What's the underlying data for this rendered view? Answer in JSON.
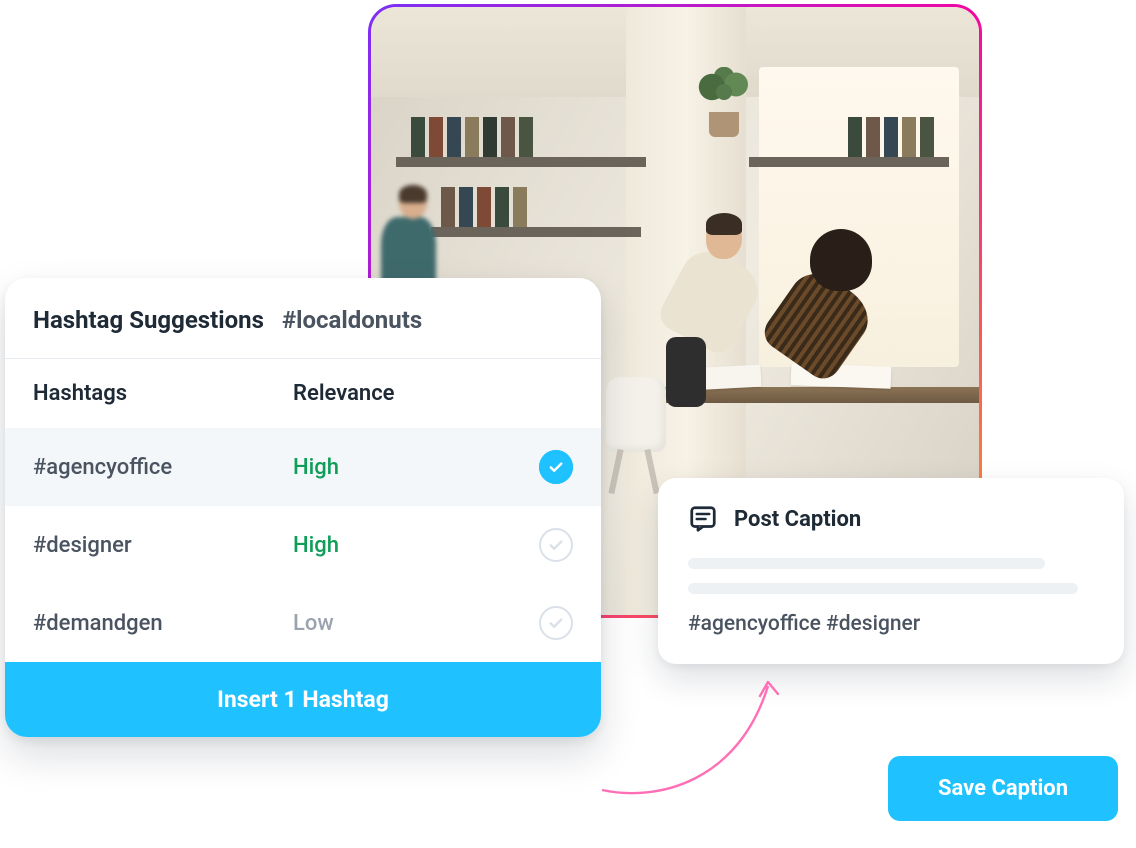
{
  "panel": {
    "title": "Hashtag Suggestions",
    "current_tag": "#localdonuts",
    "columns": {
      "hashtags": "Hashtags",
      "relevance": "Relevance"
    },
    "rows": [
      {
        "tag": "#agencyoffice",
        "relevance": "High",
        "relevance_level": "high",
        "selected": true
      },
      {
        "tag": "#designer",
        "relevance": "High",
        "relevance_level": "high",
        "selected": false
      },
      {
        "tag": "#demandgen",
        "relevance": "Low",
        "relevance_level": "low",
        "selected": false
      }
    ],
    "insert_button": "Insert 1 Hashtag"
  },
  "caption_card": {
    "title": "Post Caption",
    "caption_text": "#agencyoffice #designer"
  },
  "save_button": "Save Caption",
  "colors": {
    "accent": "#1fc1ff",
    "high": "#0f9d58",
    "low": "#9aa3ae"
  }
}
